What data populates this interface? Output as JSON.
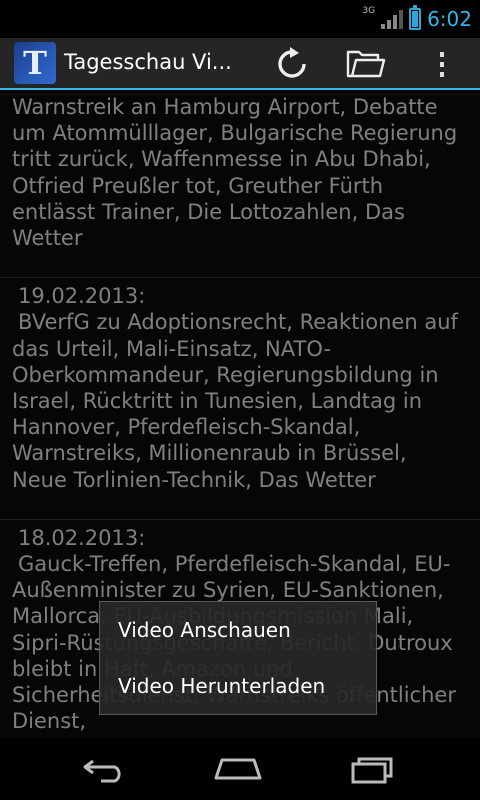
{
  "status_bar": {
    "network_label": "3G",
    "time": "6:02"
  },
  "action_bar": {
    "app_icon_letter": "T",
    "title": "Tagesschau Vi...",
    "actions": [
      "refresh-icon",
      "folder-icon",
      "overflow-menu-icon"
    ]
  },
  "episodes": [
    {
      "date": "",
      "description": "Warnstreik an Hamburg Airport, Debatte um Atommülllager, Bulgarische Regierung tritt zurück, Waffenmesse in Abu Dhabi, Otfried Preußler tot, Greuther Fürth entlässt Trainer, Die Lottozahlen, Das Wetter"
    },
    {
      "date": "19.02.2013:",
      "description": "BVerfG zu Adoptionsrecht, Reaktionen auf das Urteil, Mali-Einsatz, NATO-Oberkommandeur, Regierungsbildung in Israel, Rücktritt in Tunesien, Landtag in Hannover, Pferdefleisch-Skandal, Warnstreiks, Millionenraub in Brüssel, Neue Torlinien-Technik, Das Wetter"
    },
    {
      "date": "18.02.2013:",
      "description": "Gauck-Treffen, Pferdefleisch-Skandal, EU-Außenminister zu Syrien, EU-Sanktionen, Mallorca, EU-Ausbildungsmission Mali, Sipri-Rüstungsgeschäfte, Bericht, Dutroux bleibt in Haft, Amazon und Sicherheitsdienst, Warnstreiks öffentlicher Dienst,"
    }
  ],
  "context_menu": {
    "items": [
      "Video Anschauen",
      "Video Herunterladen"
    ]
  },
  "nav_bar": {
    "buttons": [
      "back-icon",
      "home-icon",
      "recent-apps-icon"
    ]
  },
  "colors": {
    "accent": "#33b5e5",
    "action_bar_bg": "#252525",
    "content_bg": "#0b0b0b"
  }
}
